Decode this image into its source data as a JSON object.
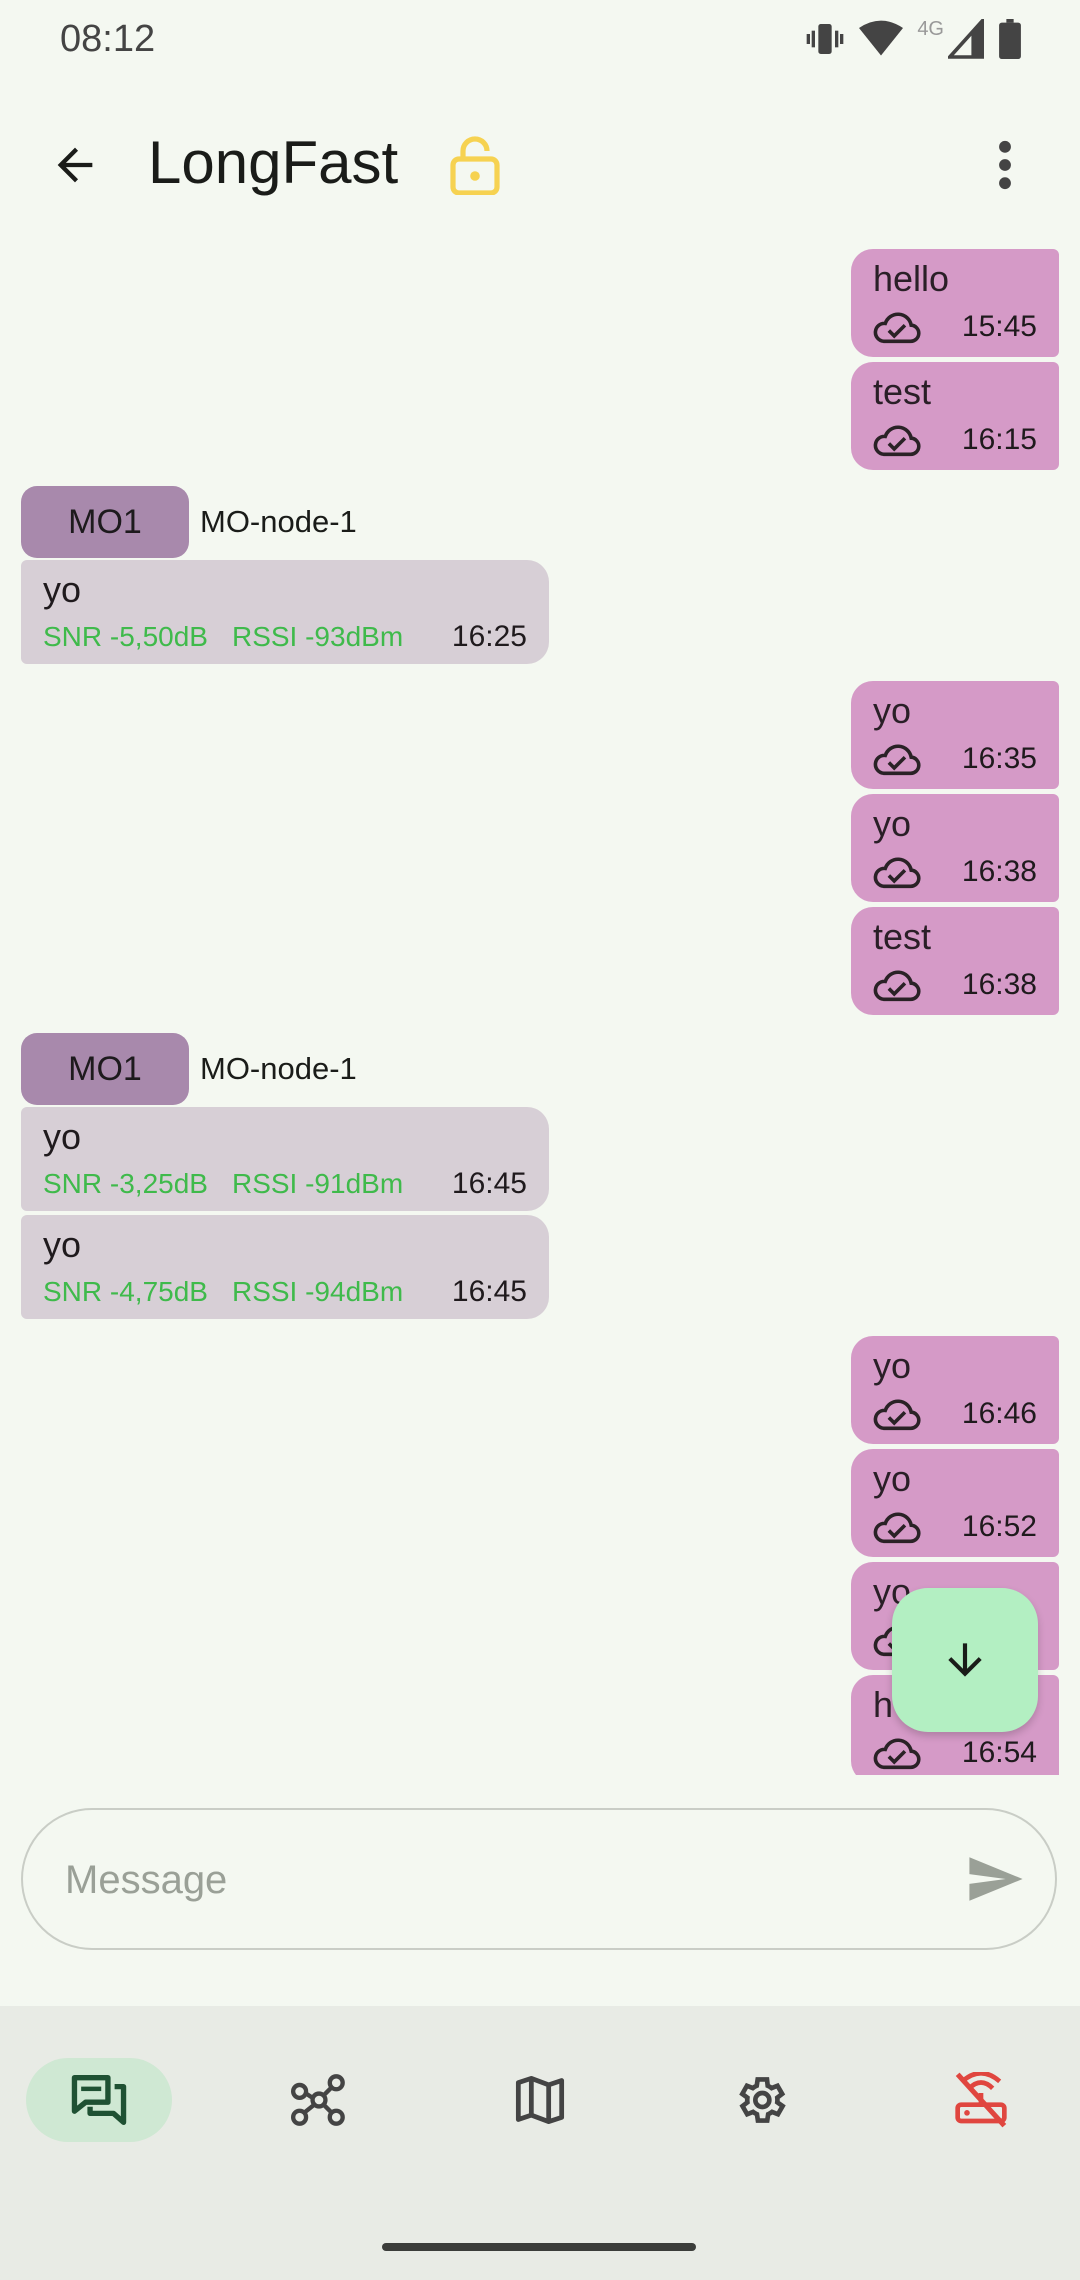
{
  "status_bar": {
    "time": "08:12",
    "network": "4G"
  },
  "header": {
    "title": "LongFast"
  },
  "messages": [
    {
      "dir": "out",
      "text": "hello",
      "time": "15:45"
    },
    {
      "dir": "out",
      "text": "test",
      "time": "16:15"
    },
    {
      "dir": "sender",
      "short": "MO1",
      "name": "MO-node-1"
    },
    {
      "dir": "in",
      "text": "yo",
      "snr": "SNR -5,50dB",
      "rssi": "RSSI -93dBm",
      "time": "16:25"
    },
    {
      "dir": "out",
      "text": "yo",
      "time": "16:35"
    },
    {
      "dir": "out",
      "text": "yo",
      "time": "16:38"
    },
    {
      "dir": "out",
      "text": "test",
      "time": "16:38"
    },
    {
      "dir": "sender",
      "short": "MO1",
      "name": "MO-node-1"
    },
    {
      "dir": "in",
      "text": "yo",
      "snr": "SNR -3,25dB",
      "rssi": "RSSI -91dBm",
      "time": "16:45"
    },
    {
      "dir": "in",
      "text": "yo",
      "snr": "SNR -4,75dB",
      "rssi": "RSSI -94dBm",
      "time": "16:45"
    },
    {
      "dir": "out",
      "text": "yo",
      "time": "16:46"
    },
    {
      "dir": "out",
      "text": "yo",
      "time": "16:52"
    },
    {
      "dir": "out",
      "text": "yo",
      "time": ""
    },
    {
      "dir": "out",
      "text": "h",
      "time": "16:54"
    }
  ],
  "composer": {
    "placeholder": "Message"
  },
  "nav": [
    {
      "name": "nav-messages",
      "icon": "chat-icon",
      "active": true
    },
    {
      "name": "nav-nodes",
      "icon": "nodes-icon",
      "active": false
    },
    {
      "name": "nav-map",
      "icon": "map-icon",
      "active": false
    },
    {
      "name": "nav-settings",
      "icon": "gear-icon",
      "active": false
    },
    {
      "name": "nav-connection",
      "icon": "router-disconnected-icon",
      "active": false
    }
  ],
  "colors": {
    "background": "#f4f8f1",
    "outgoing_bubble": "#d59ac7",
    "incoming_bubble": "#d7cfd6",
    "sender_chip": "#a889ac",
    "signal_text": "#3fba4b",
    "fab": "#b3efc2",
    "lock_icon": "#f6d251",
    "disconnected_icon": "#e0463f"
  }
}
